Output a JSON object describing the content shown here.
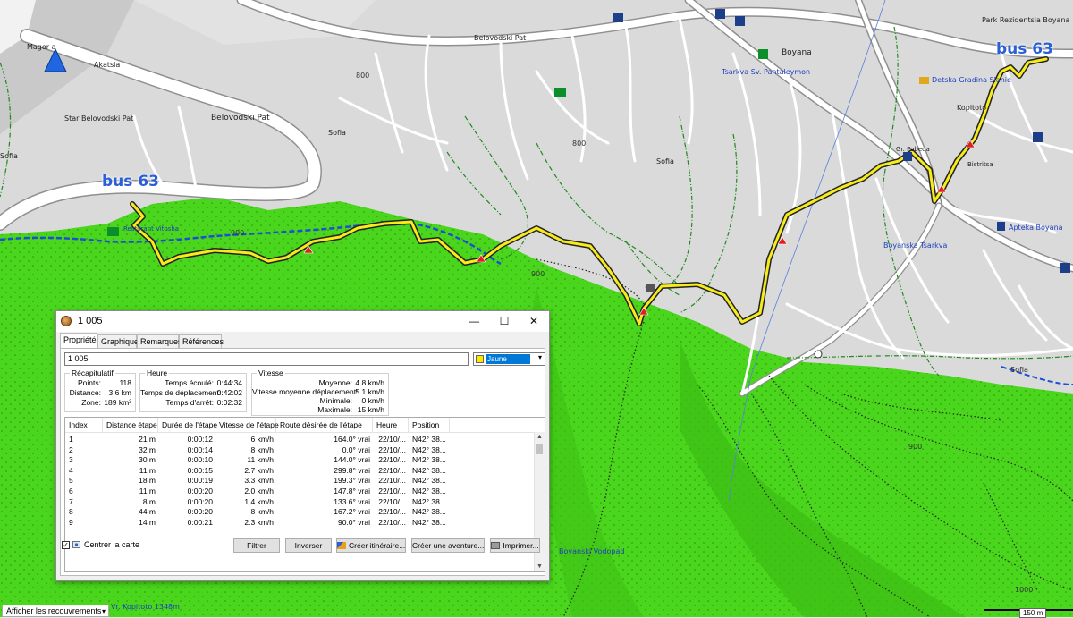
{
  "map": {
    "bus_labels": [
      "bus 63",
      "bus 63"
    ],
    "places": [
      {
        "text": "Magor a",
        "blue": false
      },
      {
        "text": "Akatsia",
        "blue": false
      },
      {
        "text": "Belovodski Pat",
        "blue": false
      },
      {
        "text": "Star Belovodski Pat",
        "blue": false
      },
      {
        "text": "Belovodski Pat",
        "blue": false
      },
      {
        "text": "Sofia",
        "blue": false
      },
      {
        "text": "Sofia",
        "blue": false
      },
      {
        "text": "Sofia",
        "blue": false
      },
      {
        "text": "Sofia",
        "blue": false
      },
      {
        "text": "Boyana",
        "blue": false
      },
      {
        "text": "Tsarkva Sv. Pantaleymon",
        "blue": true
      },
      {
        "text": "Detska Gradina Slanie",
        "blue": true
      },
      {
        "text": "Boyanska Tsarkva",
        "blue": true
      },
      {
        "text": "Apteka Boyana",
        "blue": true
      },
      {
        "text": "Park Rezidentsia Boyana",
        "blue": false
      },
      {
        "text": "Kopitoto",
        "blue": false
      },
      {
        "text": "Boyanski Vodopad",
        "blue": true
      },
      {
        "text": "Vr. Kopitoto 1348m",
        "blue": true
      },
      {
        "text": "Restorant Vitosha",
        "blue": true
      },
      {
        "text": "Gr. Pobeda",
        "blue": false
      },
      {
        "text": "Bistritsa",
        "blue": false
      }
    ],
    "contours": [
      "900",
      "800",
      "800",
      "900",
      "900",
      "1000"
    ],
    "status_select": "Afficher les recouvrements",
    "scale": "150 m"
  },
  "dialog": {
    "title": "1 005",
    "win_buttons": {
      "minimize": "—",
      "maximize": "☐",
      "close": "✕"
    },
    "tabs": [
      "Propriétés",
      "Graphique",
      "Remarques",
      "Références"
    ],
    "name_value": "1 005",
    "color": {
      "name": "Jaune",
      "hex": "#ffe800"
    },
    "summary": {
      "title": "Récapitulatif",
      "rows": [
        {
          "k": "Points:",
          "v": "118"
        },
        {
          "k": "Distance:",
          "v": "3.6 km"
        },
        {
          "k": "Zone:",
          "v": "189 km²"
        }
      ]
    },
    "time": {
      "title": "Heure",
      "rows": [
        {
          "k": "Temps écoulé:",
          "v": "0:44:34"
        },
        {
          "k": "Temps de déplacement:",
          "v": "0:42:02"
        },
        {
          "k": "Temps d'arrêt:",
          "v": "0:02:32"
        }
      ]
    },
    "speed": {
      "title": "Vitesse",
      "rows": [
        {
          "k": "Moyenne:",
          "v": "4.8 km/h"
        },
        {
          "k": "Vitesse moyenne déplacement:",
          "v": "5.1 km/h"
        },
        {
          "k": "Minimale:",
          "v": "0 km/h"
        },
        {
          "k": "Maximale:",
          "v": "15 km/h"
        }
      ]
    },
    "columns": [
      "Index",
      "Distance étape",
      "Durée de l'étape",
      "Vitesse de l'étape",
      "Route désirée de l'étape",
      "Heure",
      "Position"
    ],
    "rows": [
      [
        "1",
        "21 m",
        "0:00:12",
        "6 km/h",
        "164.0° vrai",
        "22/10/...",
        "N42° 38..."
      ],
      [
        "2",
        "32 m",
        "0:00:14",
        "8 km/h",
        "0.0° vrai",
        "22/10/...",
        "N42° 38..."
      ],
      [
        "3",
        "30 m",
        "0:00:10",
        "11 km/h",
        "144.0° vrai",
        "22/10/...",
        "N42° 38..."
      ],
      [
        "4",
        "11 m",
        "0:00:15",
        "2.7 km/h",
        "299.8° vrai",
        "22/10/...",
        "N42° 38..."
      ],
      [
        "5",
        "18 m",
        "0:00:19",
        "3.3 km/h",
        "199.3° vrai",
        "22/10/...",
        "N42° 38..."
      ],
      [
        "6",
        "11 m",
        "0:00:20",
        "2.0 km/h",
        "147.8° vrai",
        "22/10/...",
        "N42° 38..."
      ],
      [
        "7",
        "8 m",
        "0:00:20",
        "1.4 km/h",
        "133.6° vrai",
        "22/10/...",
        "N42° 38..."
      ],
      [
        "8",
        "44 m",
        "0:00:20",
        "8 km/h",
        "167.2° vrai",
        "22/10/...",
        "N42° 38..."
      ],
      [
        "9",
        "14 m",
        "0:00:21",
        "2.3 km/h",
        "90.0° vrai",
        "22/10/...",
        "N42° 38..."
      ]
    ],
    "center_map_label": "Centrer la carte",
    "buttons": {
      "filter": "Filtrer",
      "invert": "Inverser",
      "create_route": "Créer itinéraire...",
      "create_adventure": "Créer une aventure...",
      "print": "Imprimer..."
    }
  }
}
